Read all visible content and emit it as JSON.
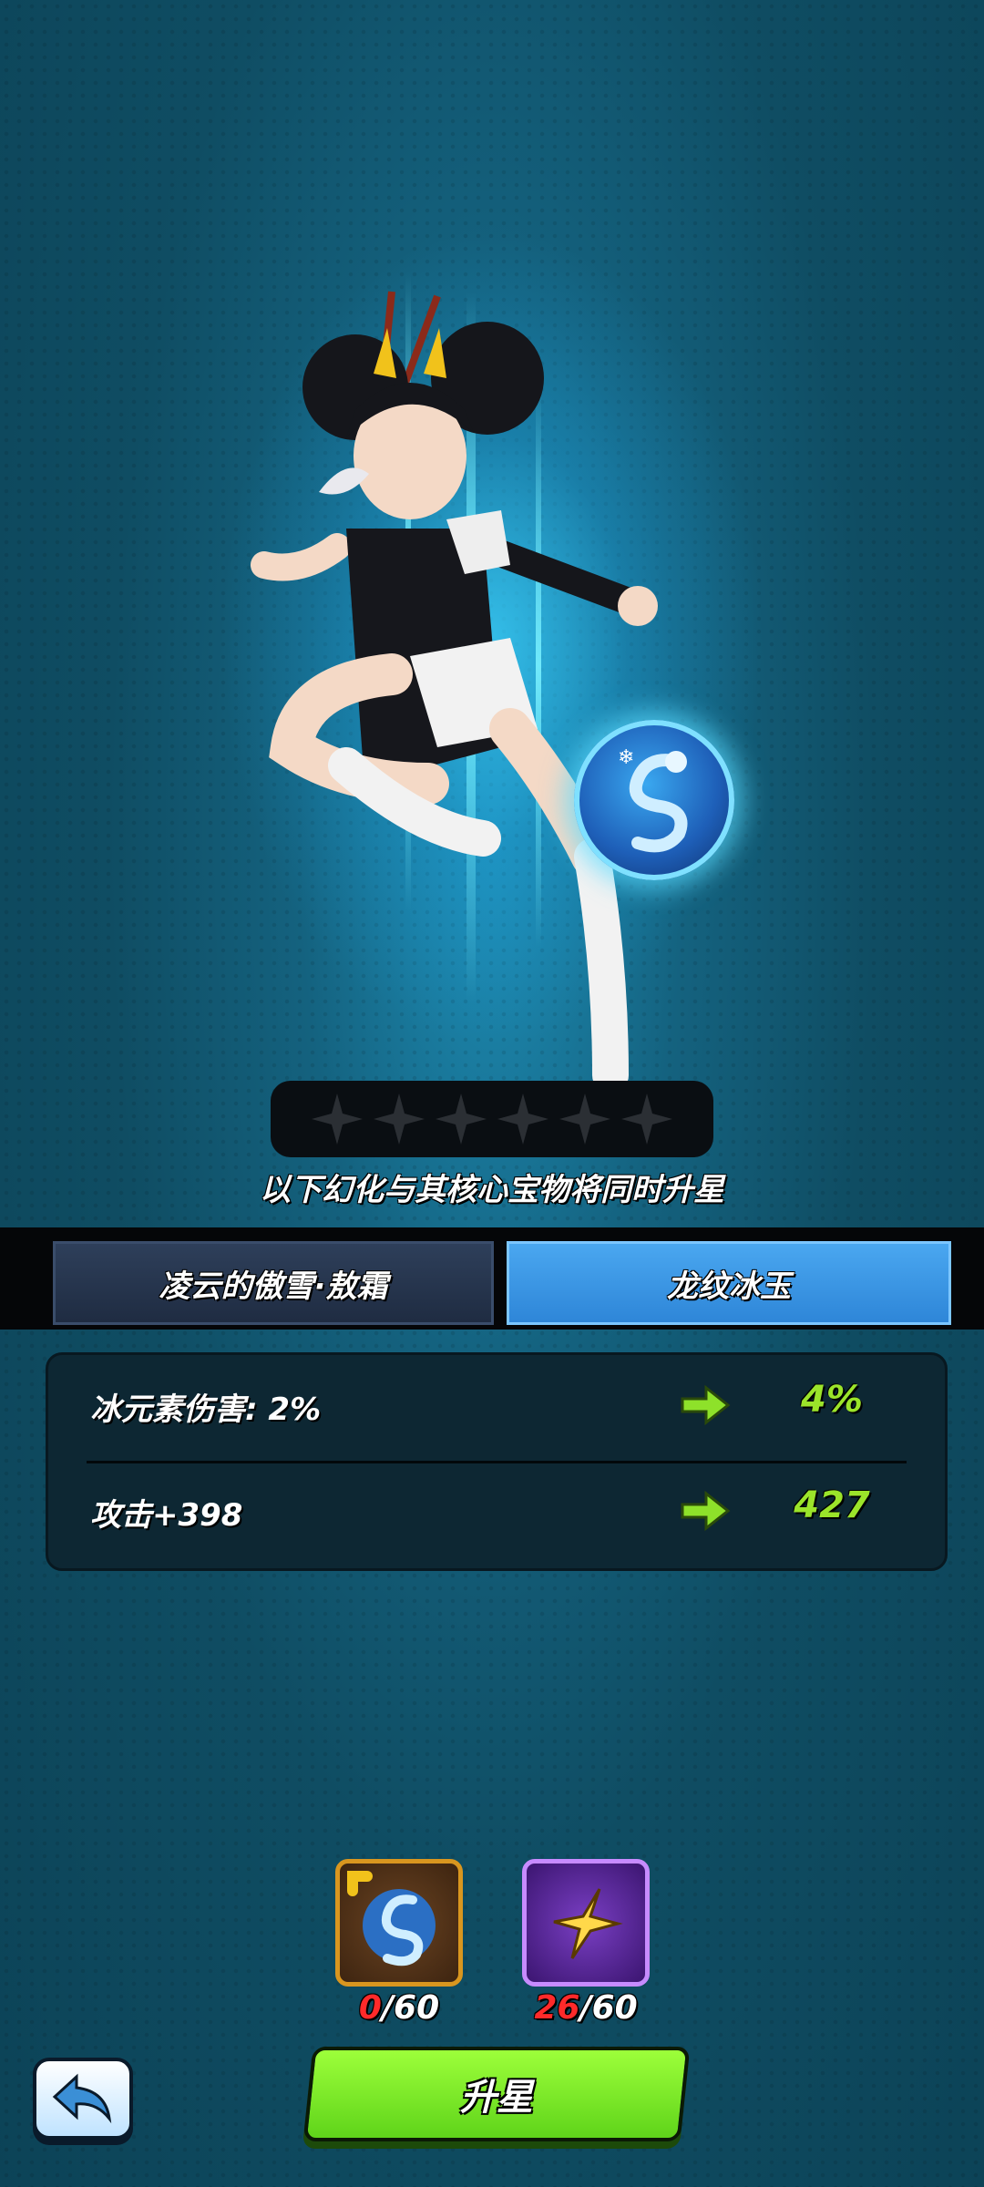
{
  "notice": "以下幻化与其核心宝物将同时升星",
  "stars": {
    "filled": 0,
    "total": 6
  },
  "tabs": [
    {
      "label": "凌云的傲雪·敖霜",
      "active": false
    },
    {
      "label": "龙纹冰玉",
      "active": true
    }
  ],
  "stats": [
    {
      "label": "冰元素伤害: 2%",
      "next": "4%"
    },
    {
      "label": "攻击+398",
      "next": "427"
    }
  ],
  "materials": [
    {
      "icon": "dragon-jade-fragment-icon",
      "have": "0",
      "need": "/60"
    },
    {
      "icon": "gold-star-icon",
      "have": "26",
      "need": "/60"
    }
  ],
  "buttons": {
    "upgrade": "升星",
    "back_icon": "back-arrow-icon"
  },
  "colors": {
    "accent_green": "#9be42a",
    "tab_active": "#3a98e6",
    "count_short": "#ff2a2a"
  }
}
